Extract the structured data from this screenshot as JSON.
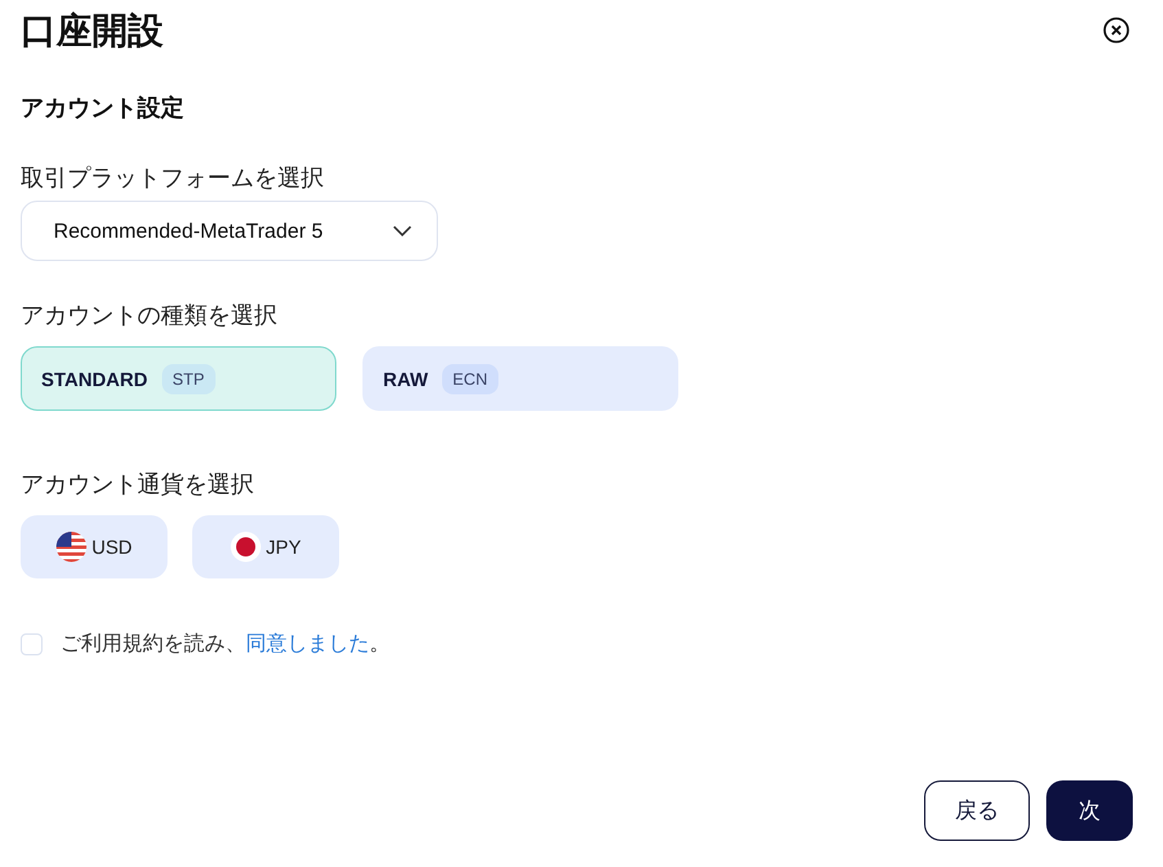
{
  "title": "口座開設",
  "section_title": "アカウント設定",
  "platform": {
    "label": "取引プラットフォームを選択",
    "value": "Recommended-MetaTrader 5"
  },
  "account_type": {
    "label": "アカウントの種類を選択",
    "options": [
      {
        "name": "STANDARD",
        "tag": "STP",
        "selected": true
      },
      {
        "name": "RAW",
        "tag": "ECN",
        "selected": false
      }
    ]
  },
  "currency": {
    "label": "アカウント通貨を選択",
    "options": [
      {
        "code": "USD",
        "kind": "us",
        "selected": false
      },
      {
        "code": "JPY",
        "kind": "jp",
        "selected": false
      }
    ]
  },
  "agreement": {
    "checked": false,
    "text": "ご利用規約を読み、",
    "link": "同意しました",
    "end": "。"
  },
  "buttons": {
    "back": "戻る",
    "next": "次"
  }
}
